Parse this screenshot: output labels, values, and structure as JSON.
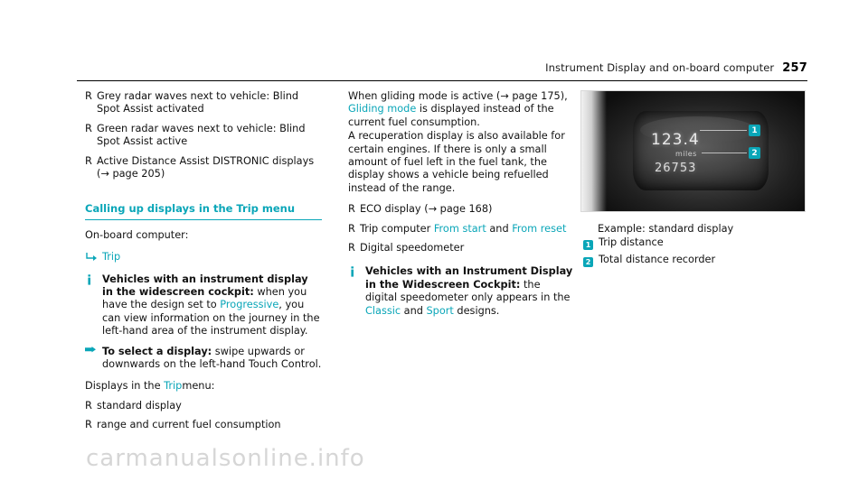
{
  "header": {
    "title": "Instrument Display and on-board computer",
    "page_number": "257"
  },
  "column1": {
    "bullets": [
      {
        "marker": "R",
        "text": "Grey radar waves next to vehicle: Blind Spot Assist activated"
      },
      {
        "marker": "R",
        "text": "Green radar waves next to vehicle: Blind Spot Assist active"
      },
      {
        "marker": "R",
        "text": "Active Distance Assist DISTRONIC displays (→ page 205)"
      }
    ],
    "section_heading": "Calling up displays in the Trip menu",
    "lead": "On-board computer:",
    "trip_marker": "→",
    "trip_label": "Trip",
    "note1": {
      "icon": "i",
      "bold": "Vehicles with an instrument display in the widescreen cockpit:",
      "rest_a": " when you have the design set to ",
      "link": "Progressive",
      "rest_b": ", you can view information on the journey in the left-hand area of the instrument display."
    },
    "note2": {
      "icon": "▶",
      "bold": "To select a display:",
      "rest": " swipe upwards or downwards on the left-hand Touch Control."
    },
    "displays_line_pre": "Displays in the ",
    "displays_link": "Trip",
    "displays_line_post": "menu:",
    "display_bullets": [
      {
        "marker": "R",
        "text": "standard display"
      },
      {
        "marker": "R",
        "text": "range and current fuel consumption"
      }
    ]
  },
  "column2": {
    "para1_pre": "When gliding mode is active (→ page 175), ",
    "para1_link": "Gliding mode",
    "para1_post": " is displayed instead of the current fuel consumption.",
    "para2": "A recuperation display is also available for certain engines. If there is only a small amount of fuel left in the fuel tank, the display shows a vehicle being refuelled instead of the range.",
    "bullets": [
      {
        "marker": "R",
        "text": "ECO display (→ page 168)"
      },
      {
        "marker": "R",
        "pre": "Trip computer ",
        "link1": "From start",
        "mid": " and ",
        "link2": "From reset"
      },
      {
        "marker": "R",
        "text": "Digital speedometer"
      }
    ],
    "note": {
      "icon": "i",
      "bold": "Vehicles with an Instrument Display in the Widescreen Cockpit:",
      "rest_a": " the digital speedometer only appears in the ",
      "link1": "Classic",
      "mid": " and ",
      "link2": "Sport",
      "rest_b": " designs."
    }
  },
  "figure": {
    "reading_main": "123.4",
    "reading_unit": "miles",
    "reading_odo": "26753",
    "callout_1": "1",
    "callout_2": "2",
    "caption": "Example: standard display",
    "legend": [
      {
        "num": "1",
        "label": "Trip distance"
      },
      {
        "num": "2",
        "label": "Total distance recorder"
      }
    ]
  },
  "watermark": "carmanualsonline.info"
}
